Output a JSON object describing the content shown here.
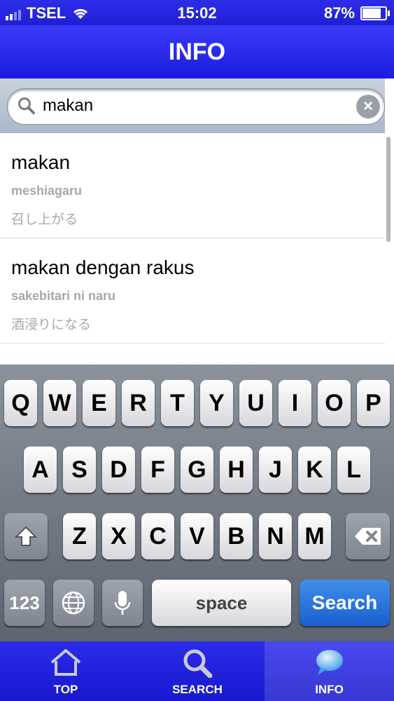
{
  "status": {
    "carrier": "TSEL",
    "time": "15:02",
    "battery": "87%",
    "battery_level": 0.87
  },
  "nav": {
    "title": "INFO"
  },
  "search": {
    "value": "makan"
  },
  "results": [
    {
      "word": "makan",
      "romaji": "meshiagaru",
      "japanese": "召し上がる"
    },
    {
      "word": "makan dengan rakus",
      "romaji": "sakebitari ni naru",
      "japanese": "酒浸りになる"
    }
  ],
  "keyboard": {
    "row1": [
      "Q",
      "W",
      "E",
      "R",
      "T",
      "Y",
      "U",
      "I",
      "O",
      "P"
    ],
    "row2": [
      "A",
      "S",
      "D",
      "F",
      "G",
      "H",
      "J",
      "K",
      "L"
    ],
    "row3": [
      "Z",
      "X",
      "C",
      "V",
      "B",
      "N",
      "M"
    ],
    "numbers_label": "123",
    "space_label": "space",
    "search_label": "Search"
  },
  "tabs": [
    {
      "label": "TOP",
      "icon": "home-icon"
    },
    {
      "label": "SEARCH",
      "icon": "search-icon"
    },
    {
      "label": "INFO",
      "icon": "chat-bubble-icon",
      "active": true
    }
  ]
}
